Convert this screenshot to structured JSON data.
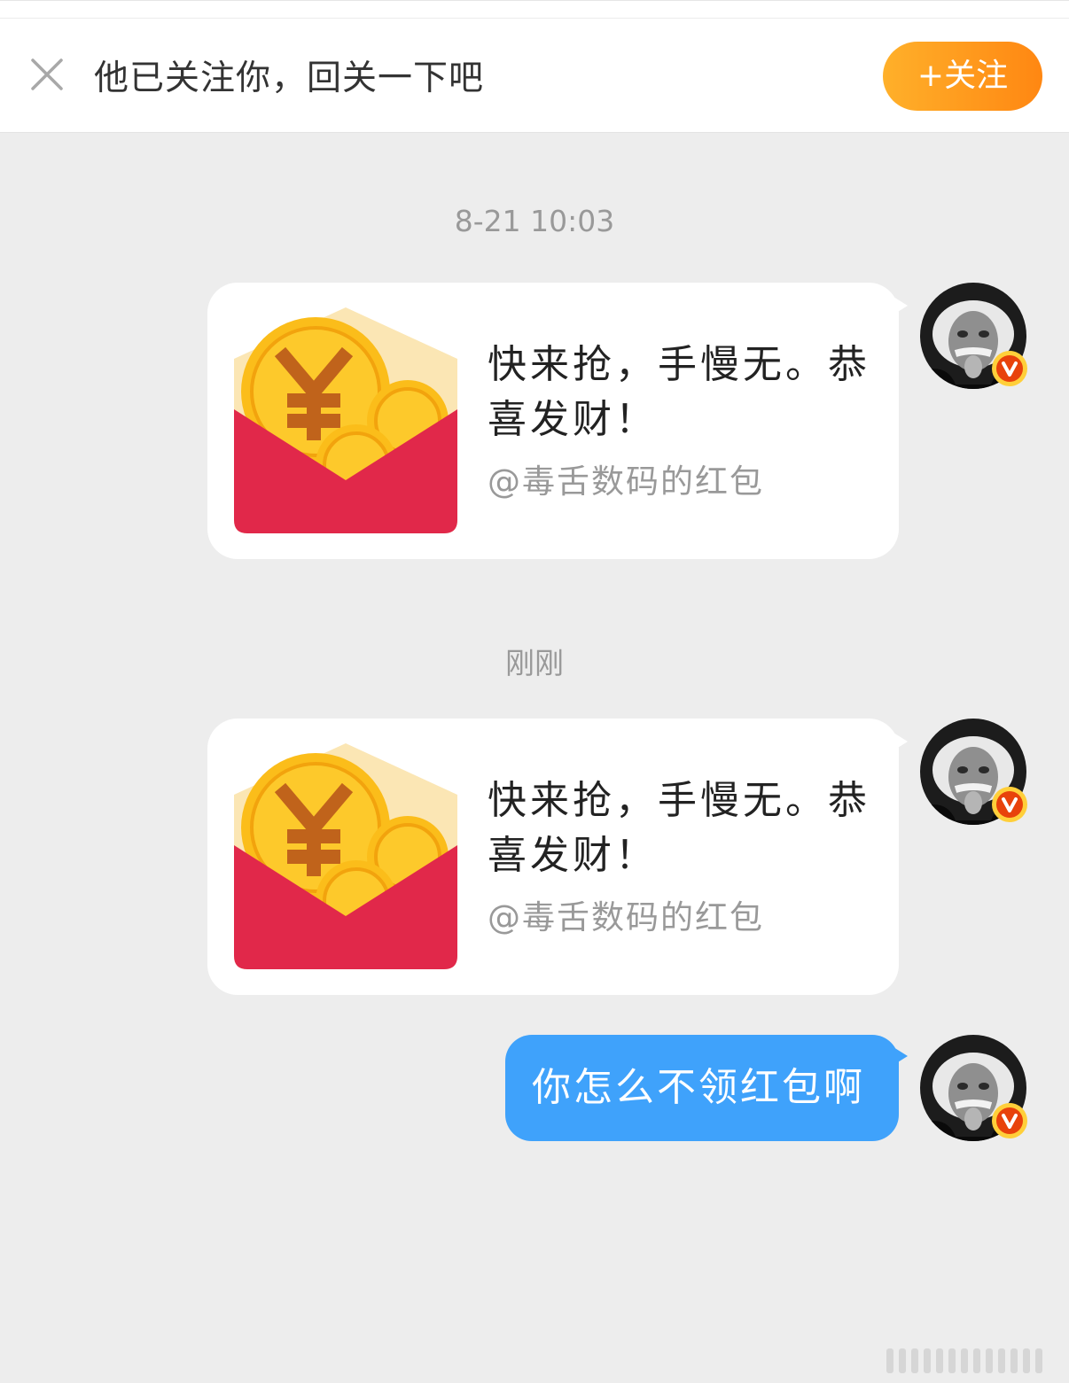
{
  "follow_bar": {
    "close_icon": "close-icon",
    "notice": "他已关注你，回关一下吧",
    "follow_label": "+关注",
    "follow_color": "#ff9a1f"
  },
  "messages": [
    {
      "time": "8-21 10:03",
      "type": "red-packet",
      "title": "快来抢，手慢无。恭喜发财！",
      "subtitle": "@毒舌数码的红包"
    },
    {
      "time": "刚刚",
      "type": "red-packet",
      "title": "快来抢，手慢无。恭喜发财！",
      "subtitle": "@毒舌数码的红包"
    },
    {
      "type": "text",
      "text": "你怎么不领红包啊",
      "bubble_color": "#3fa2fb"
    }
  ],
  "avatar": {
    "icon": "avatar",
    "badge_icon": "verified-v-icon",
    "badge_color": "#e8420b"
  },
  "colors": {
    "background": "#ededed",
    "envelope_red": "#e1284a",
    "coin_gold": "#fbbd1a"
  }
}
